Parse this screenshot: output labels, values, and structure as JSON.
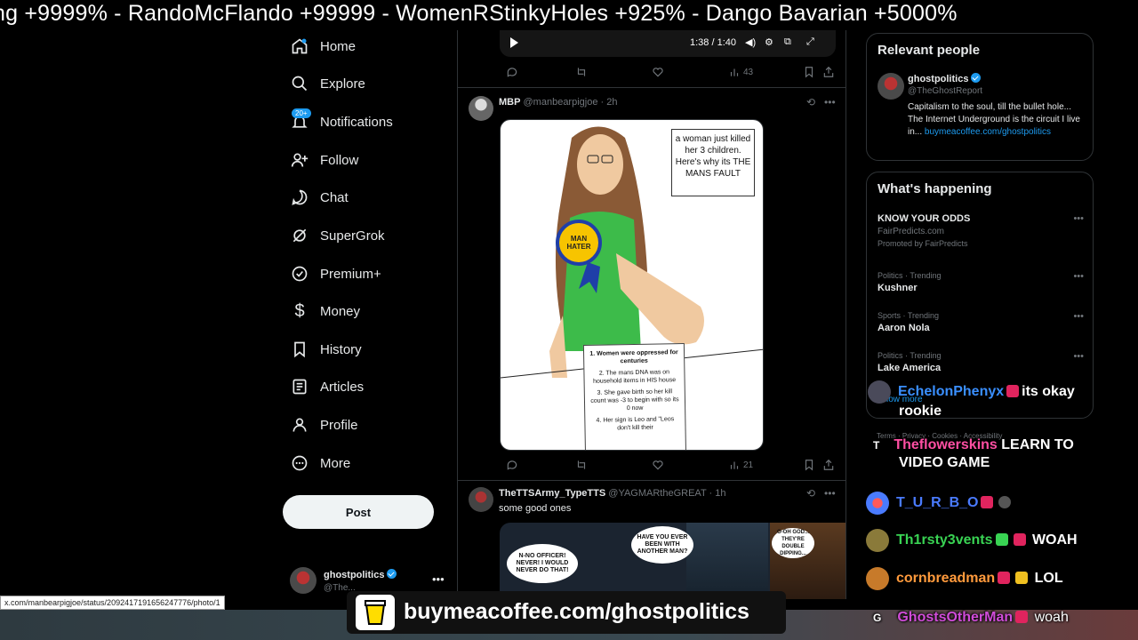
{
  "ticker": {
    "text": "ng +9999%   -  RandoMcFlando +99999   -  WomenRStinkyHoles +925%   -  Dango Bavarian +5000%"
  },
  "nav": {
    "items": [
      {
        "label": "Home",
        "icon": "home-icon"
      },
      {
        "label": "Explore",
        "icon": "search-icon"
      },
      {
        "label": "Notifications",
        "icon": "bell-icon",
        "badge": "20+"
      },
      {
        "label": "Follow",
        "icon": "follow-icon"
      },
      {
        "label": "Chat",
        "icon": "chat-icon"
      },
      {
        "label": "SuperGrok",
        "icon": "grok-icon"
      },
      {
        "label": "Premium+",
        "icon": "premium-icon"
      },
      {
        "label": "Money",
        "icon": "money-icon"
      },
      {
        "label": "History",
        "icon": "bookmark-icon"
      },
      {
        "label": "Articles",
        "icon": "articles-icon"
      },
      {
        "label": "Profile",
        "icon": "profile-icon"
      },
      {
        "label": "More",
        "icon": "more-icon"
      }
    ],
    "post_label": "Post",
    "account": {
      "name": "ghostpolitics",
      "handle": "@The..."
    }
  },
  "video": {
    "time": "1:38 / 1:40"
  },
  "tweet1_actions": {
    "views": "43"
  },
  "tweet2": {
    "name": "MBP",
    "handle": "@manbearpigjoe",
    "time": "· 2h",
    "speech": "a woman just killed her 3 children. Here's why its THE MANS FAULT",
    "badge": "MAN HATER",
    "paper": {
      "heading": "1. Women were oppressed for centuries",
      "p2": "2. The mans DNA was on household items in HIS house",
      "p3": "3. She gave birth so her kill count was -3 to begin with so its 0 now",
      "p4": "4. Her sign is Leo and \"Leos don't kill their"
    },
    "views": "21"
  },
  "tweet3": {
    "name": "TheTTSArmy_TypeTTS",
    "handle": "@YAGMARtheGREAT",
    "time": "· 1h",
    "text": "some good ones",
    "bubble1": "N-NO OFFICER! NEVER! I WOULD NEVER DO THAT!",
    "bubble2": "HAVE YOU EVER BEEN WITH ANOTHER MAN?",
    "bubble3": "O-OH GOD... THEY'RE DOUBLE DIPPING..."
  },
  "relevant": {
    "title": "Relevant people",
    "name": "ghostpolitics",
    "handle": "@TheGhostReport",
    "bio": "Capitalism to the soul, till the bullet hole... The Internet Underground is the circuit I live in...",
    "link": "buymeacoffee.com/ghostpolitics"
  },
  "happening": {
    "title": "What's happening",
    "trends": [
      {
        "meta": "",
        "title": "KNOW YOUR ODDS",
        "sub": "FairPredicts.com",
        "promo": "Promoted by FairPredicts"
      },
      {
        "meta": "Politics · Trending",
        "title": "Kushner"
      },
      {
        "meta": "Sports · Trending",
        "title": "Aaron Nola"
      },
      {
        "meta": "Politics · Trending",
        "title": "Lake America"
      }
    ],
    "show_more": "Show more"
  },
  "chat": [
    {
      "user": "EchelonPhenyx",
      "color": "#3a8fff",
      "msg": "its okay",
      "msg2": "rookie"
    },
    {
      "user": "Theflowerskins",
      "color": "#ff4fa3",
      "msg": "LEARN TO",
      "msg2": "VIDEO GAME",
      "prefix": "T"
    },
    {
      "user": "T_U_R_B_O",
      "color": "#4a7bff",
      "msg": ""
    },
    {
      "user": "Th1rsty3vents",
      "color": "#39d353",
      "msg": "WOAH"
    },
    {
      "user": "cornbreadman",
      "color": "#ff9a3c",
      "msg": "LOL"
    },
    {
      "user": "GhostsOtherMan",
      "color": "#d04cd8",
      "msg": "woah",
      "prefix": "G"
    }
  ],
  "footer_links": "Terms  ·  Privacy  ·  Cookies  ·  Accessibility",
  "status_url": "x.com/manbearpigjoe/status/2092417191656247776/photo/1",
  "coffee": "buymeacoffee.com/ghostpolitics"
}
